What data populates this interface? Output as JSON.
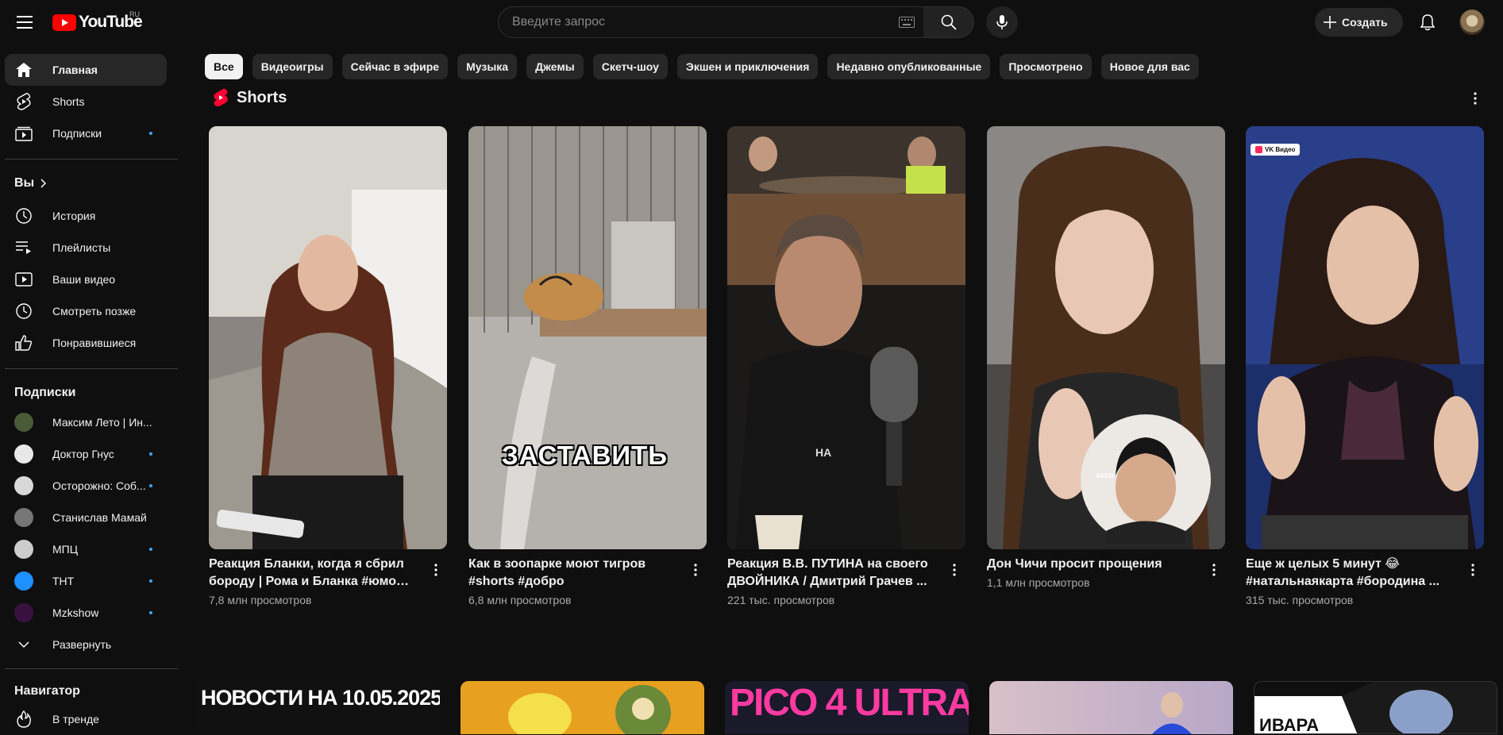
{
  "header": {
    "logo_text": "YouTube",
    "region": "RU",
    "search_placeholder": "Введите запрос",
    "create_label": "Создать"
  },
  "sidebar": {
    "main": [
      {
        "label": "Главная",
        "icon": "home-icon"
      },
      {
        "label": "Shorts",
        "icon": "shorts-icon"
      },
      {
        "label": "Подписки",
        "icon": "subscriptions-icon"
      }
    ],
    "you_heading": "Вы",
    "you": [
      {
        "label": "История",
        "icon": "history-icon"
      },
      {
        "label": "Плейлисты",
        "icon": "playlists-icon"
      },
      {
        "label": "Ваши видео",
        "icon": "your-videos-icon"
      },
      {
        "label": "Смотреть позже",
        "icon": "watch-later-icon"
      },
      {
        "label": "Понравившиеся",
        "icon": "like-icon"
      }
    ],
    "subs_heading": "Подписки",
    "subscriptions": [
      {
        "label": "Максим Лето | Ин...",
        "color": "#4a5b3a",
        "new": false
      },
      {
        "label": "Доктор Гнус",
        "color": "#e8e8e8",
        "new": true
      },
      {
        "label": "Осторожно: Соб...",
        "color": "#d8d8d8",
        "new": true
      },
      {
        "label": "Станислав Мамай",
        "color": "#777777",
        "new": false
      },
      {
        "label": "МПЦ",
        "color": "#cccccc",
        "new": true
      },
      {
        "label": "ТНТ",
        "color": "#1e90ff",
        "new": true
      },
      {
        "label": "Mzkshow",
        "color": "#3a1040",
        "new": true
      }
    ],
    "expand_label": "Развернуть",
    "nav_heading": "Навигатор",
    "nav": [
      {
        "label": "В тренде",
        "icon": "trending-icon"
      }
    ]
  },
  "chips": [
    "Все",
    "Видеоигры",
    "Сейчас в эфире",
    "Музыка",
    "Джемы",
    "Скетч-шоу",
    "Экшен и приключения",
    "Недавно опубликованные",
    "Просмотрено",
    "Новое для вас"
  ],
  "shorts_shelf": {
    "title": "Shorts",
    "items": [
      {
        "title": "Реакция Бланки, когда я сбрил бороду | Рома и Бланка #юмор ...",
        "views": "7,8 млн просмотров"
      },
      {
        "title": "Как в зоопарке моют тигров #shorts #добро",
        "views": "6,8 млн просмотров",
        "overlay": "ЗАСТАВИТЬ"
      },
      {
        "title": "Реакция В.В. ПУТИНА на своего ДВОЙНИКА / Дмитрий Грачев ...",
        "views": "221 тыс. просмотров",
        "overlay": "НА"
      },
      {
        "title": "Дон Чичи просит прощения",
        "views": "1,1 млн просмотров",
        "overlay": "AREN"
      },
      {
        "title": "Еще ж целых 5 минут 😂 #натальнаякарта #бородина ...",
        "views": "315 тыс. просмотров",
        "badge": "VK Видео"
      }
    ]
  },
  "bottom_row": [
    {
      "caption": "НОВОСТИ НА 10.05.2025"
    },
    {
      "caption": ""
    },
    {
      "caption": "PICO 4 ULTRA"
    },
    {
      "caption": ""
    },
    {
      "caption": "ИВАРА"
    }
  ]
}
